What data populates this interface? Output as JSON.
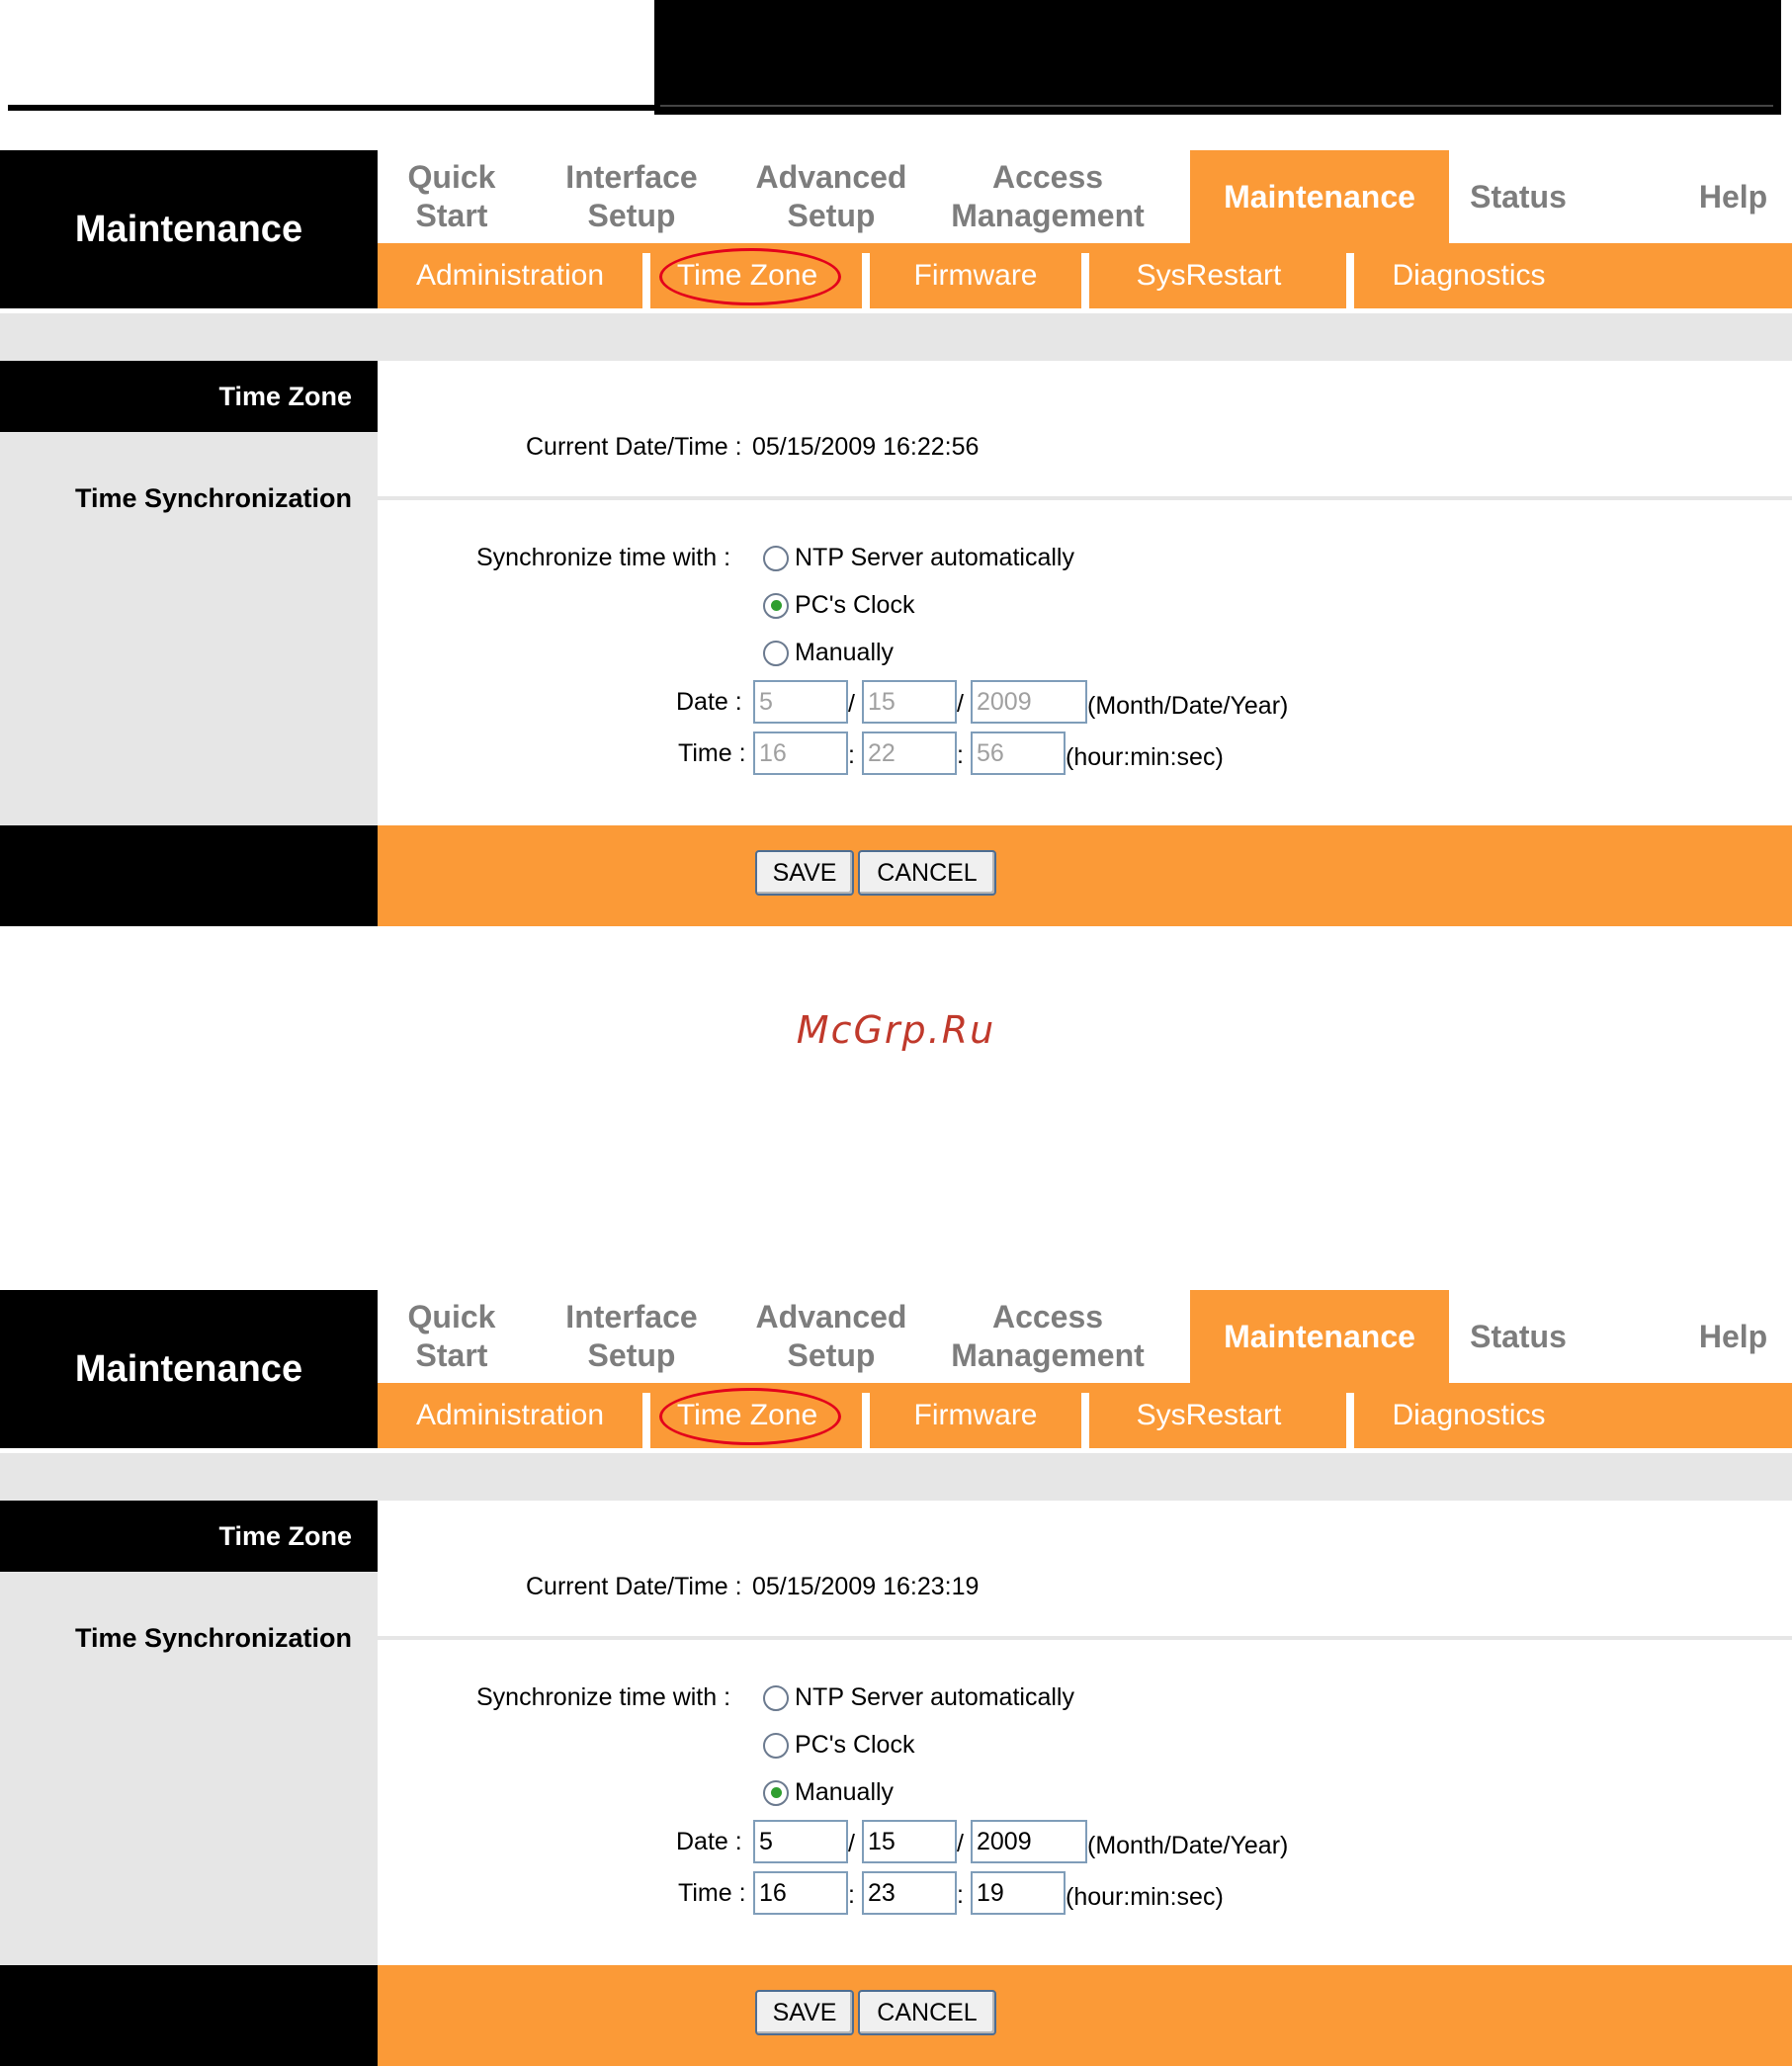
{
  "watermark": "McGrp.Ru",
  "panels": [
    {
      "brand": "Maintenance",
      "nav": [
        {
          "label": "Quick\nStart"
        },
        {
          "label": "Interface\nSetup"
        },
        {
          "label": "Advanced\nSetup"
        },
        {
          "label": "Access\nManagement"
        },
        {
          "label": "Maintenance",
          "active": true
        },
        {
          "label": "Status"
        },
        {
          "label": "Help"
        }
      ],
      "subnav": [
        "Administration",
        "Time Zone",
        "Firmware",
        "SysRestart",
        "Diagnostics"
      ],
      "highlighted_subnav": "Time Zone",
      "section_title": "Time Zone",
      "section_label": "Time Synchronization",
      "current_label": "Current Date/Time :",
      "current_value": "05/15/2009 16:22:56",
      "sync_label": "Synchronize time with :",
      "options": [
        "NTP Server automatically",
        "PC's Clock",
        "Manually"
      ],
      "selected_option": "PC's Clock",
      "date_label": "Date :",
      "date": {
        "month": "5",
        "day": "15",
        "year": "2009"
      },
      "date_hint": "(Month/Date/Year)",
      "time_label": "Time :",
      "time": {
        "hour": "16",
        "min": "22",
        "sec": "56"
      },
      "time_hint": "(hour:min:sec)",
      "fields_disabled": true,
      "save": "SAVE",
      "cancel": "CANCEL"
    },
    {
      "brand": "Maintenance",
      "nav": [
        {
          "label": "Quick\nStart"
        },
        {
          "label": "Interface\nSetup"
        },
        {
          "label": "Advanced\nSetup"
        },
        {
          "label": "Access\nManagement"
        },
        {
          "label": "Maintenance",
          "active": true
        },
        {
          "label": "Status"
        },
        {
          "label": "Help"
        }
      ],
      "subnav": [
        "Administration",
        "Time Zone",
        "Firmware",
        "SysRestart",
        "Diagnostics"
      ],
      "highlighted_subnav": "Time Zone",
      "section_title": "Time Zone",
      "section_label": "Time Synchronization",
      "current_label": "Current Date/Time :",
      "current_value": "05/15/2009 16:23:19",
      "sync_label": "Synchronize time with :",
      "options": [
        "NTP Server automatically",
        "PC's Clock",
        "Manually"
      ],
      "selected_option": "Manually",
      "date_label": "Date :",
      "date": {
        "month": "5",
        "day": "15",
        "year": "2009"
      },
      "date_hint": "(Month/Date/Year)",
      "time_label": "Time :",
      "time": {
        "hour": "16",
        "min": "23",
        "sec": "19"
      },
      "time_hint": "(hour:min:sec)",
      "fields_disabled": false,
      "save": "SAVE",
      "cancel": "CANCEL"
    }
  ],
  "colors": {
    "accent": "#fb9a37",
    "header_bg": "#000000",
    "panel_grey": "#e6e6e6",
    "highlight_ring": "#e3001b",
    "radio_dot": "#2f9e2f"
  }
}
